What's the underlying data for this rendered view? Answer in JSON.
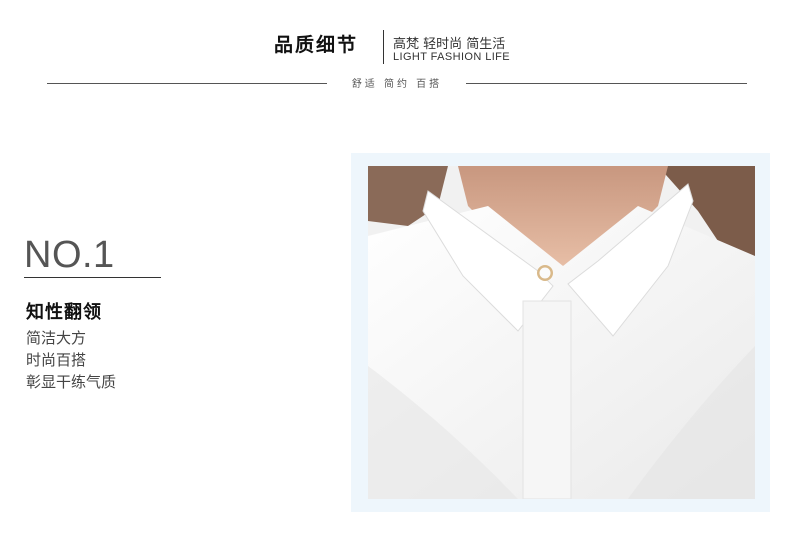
{
  "header": {
    "title": "品质细节",
    "tagline_cn": "高梵 轻时尚 简生活",
    "tagline_en": "LIGHT FASHION LIFE",
    "subtitle": "舒适  简约  百搭"
  },
  "feature": {
    "number": "NO.1",
    "title": "知性翻领",
    "lines": [
      "简洁大方",
      "时尚百搭",
      "彰显干练气质"
    ]
  },
  "photo": {
    "subject": "white shirt collar close-up",
    "colors": {
      "frame": "#eef6fc",
      "shirt": "#f7f7f7",
      "skin": "#e2b69d",
      "hair": "#8a6a58",
      "button": "#d9b98a"
    }
  }
}
